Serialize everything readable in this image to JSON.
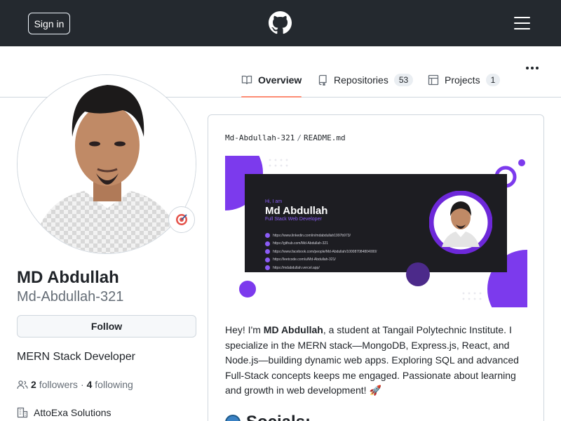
{
  "header": {
    "signin_label": "Sign in",
    "logo_icon": "github-icon",
    "menu_icon": "hamburger-icon"
  },
  "tabs": [
    {
      "label": "Overview",
      "icon": "book-icon",
      "active": true
    },
    {
      "label": "Repositories",
      "icon": "repo-icon",
      "count": "53"
    },
    {
      "label": "Projects",
      "icon": "table-icon",
      "count": "1"
    }
  ],
  "profile": {
    "name": "MD Abdullah",
    "login": "Md-Abdullah-321",
    "follow_label": "Follow",
    "bio": "MERN Stack Developer",
    "followers_count": "2",
    "followers_label": "followers",
    "following_count": "4",
    "following_label": "following",
    "separator": "·",
    "organization": "AttoExa Solutions"
  },
  "readme": {
    "owner": "Md-Abdullah-321",
    "separator": "/",
    "file": "README.md",
    "banner": {
      "greeting": "Hi, I am",
      "name": "Md Abdullah",
      "role": "Full Stack Web Developer",
      "links": [
        "https://www.linkedin.com/in/mdabdullah1997b973/",
        "https://github.com/Md-Abdullah-321",
        "https://www.facebook.com/people/Md-Abdullah/100087084804000/",
        "https://leetcode.com/u/Md-Abdullah-321/",
        "https://mdabdullah.vercel.app/"
      ]
    },
    "intro_prefix": "Hey! I'm ",
    "intro_name": "MD Abdullah",
    "intro_rest": ", a student at Tangail Polytechnic Institute. I specialize in the MERN stack—MongoDB, Express.js, React, and Node.js—building dynamic web apps. Exploring SQL and advanced Full-Stack concepts keeps me engaged. Passionate about learning and growth in web development! 🚀",
    "socials_heading": "Socials:"
  },
  "colors": {
    "header_bg": "#24292f",
    "accent_underline": "#fd8c73",
    "banner_purple": "#8b5cf6",
    "banner_dark": "#1d1d22"
  }
}
